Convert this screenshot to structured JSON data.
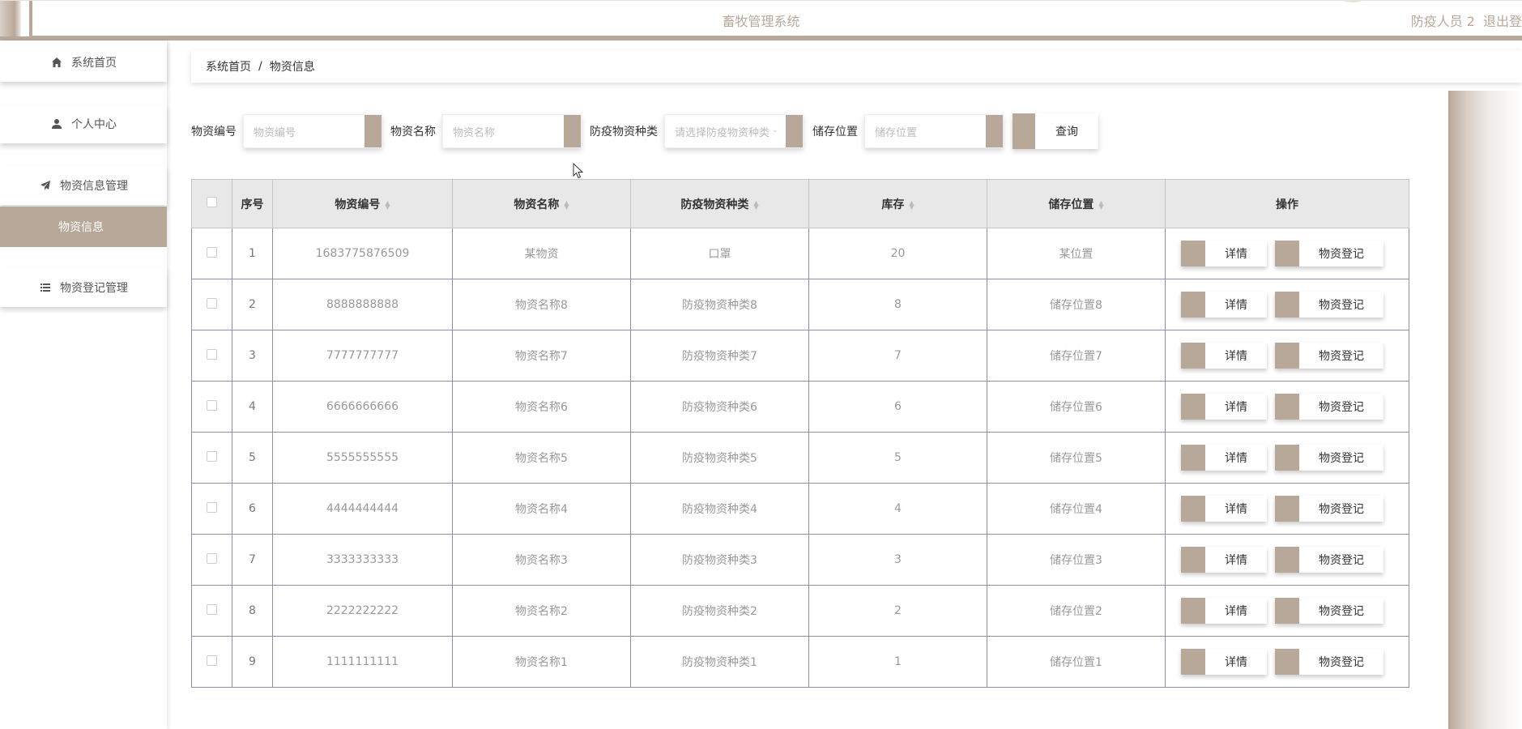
{
  "header": {
    "title": "畜牧管理系统",
    "user_name": "防疫人员 2",
    "logout": "退出登"
  },
  "sidebar": {
    "items": [
      {
        "label": "系统首页",
        "icon": "home-icon"
      },
      {
        "label": "个人中心",
        "icon": "user-icon"
      },
      {
        "label": "物资信息管理",
        "icon": "send-icon"
      },
      {
        "label": "物资登记管理",
        "icon": "list-icon"
      }
    ],
    "active_sub": "物资信息"
  },
  "breadcrumb": {
    "home": "系统首页",
    "separator": "/",
    "current": "物资信息"
  },
  "search": {
    "code_label": "物资编号",
    "code_placeholder": "物资编号",
    "name_label": "物资名称",
    "name_placeholder": "物资名称",
    "type_label": "防疫物资种类",
    "type_placeholder": "请选择防疫物资种类",
    "location_label": "储存位置",
    "location_placeholder": "储存位置",
    "query_button": "查询"
  },
  "table": {
    "headers": [
      "序号",
      "物资编号",
      "物资名称",
      "防疫物资种类",
      "库存",
      "储存位置",
      "操作"
    ],
    "rows": [
      {
        "seq": "1",
        "code": "1683775876509",
        "name": "某物资",
        "type": "口罩",
        "stock": "20",
        "location": "某位置"
      },
      {
        "seq": "2",
        "code": "8888888888",
        "name": "物资名称8",
        "type": "防疫物资种类8",
        "stock": "8",
        "location": "储存位置8"
      },
      {
        "seq": "3",
        "code": "7777777777",
        "name": "物资名称7",
        "type": "防疫物资种类7",
        "stock": "7",
        "location": "储存位置7"
      },
      {
        "seq": "4",
        "code": "6666666666",
        "name": "物资名称6",
        "type": "防疫物资种类6",
        "stock": "6",
        "location": "储存位置6"
      },
      {
        "seq": "5",
        "code": "5555555555",
        "name": "物资名称5",
        "type": "防疫物资种类5",
        "stock": "5",
        "location": "储存位置5"
      },
      {
        "seq": "6",
        "code": "4444444444",
        "name": "物资名称4",
        "type": "防疫物资种类4",
        "stock": "4",
        "location": "储存位置4"
      },
      {
        "seq": "7",
        "code": "3333333333",
        "name": "物资名称3",
        "type": "防疫物资种类3",
        "stock": "3",
        "location": "储存位置3"
      },
      {
        "seq": "8",
        "code": "2222222222",
        "name": "物资名称2",
        "type": "防疫物资种类2",
        "stock": "2",
        "location": "储存位置2"
      },
      {
        "seq": "9",
        "code": "1111111111",
        "name": "物资名称1",
        "type": "防疫物资种类1",
        "stock": "1",
        "location": "储存位置1"
      }
    ],
    "detail_button": "详情",
    "register_button": "物资登记"
  },
  "colors": {
    "accent": "#b8a89a",
    "header_bg": "#e8e8e8",
    "row_border": "#8e8fac"
  }
}
